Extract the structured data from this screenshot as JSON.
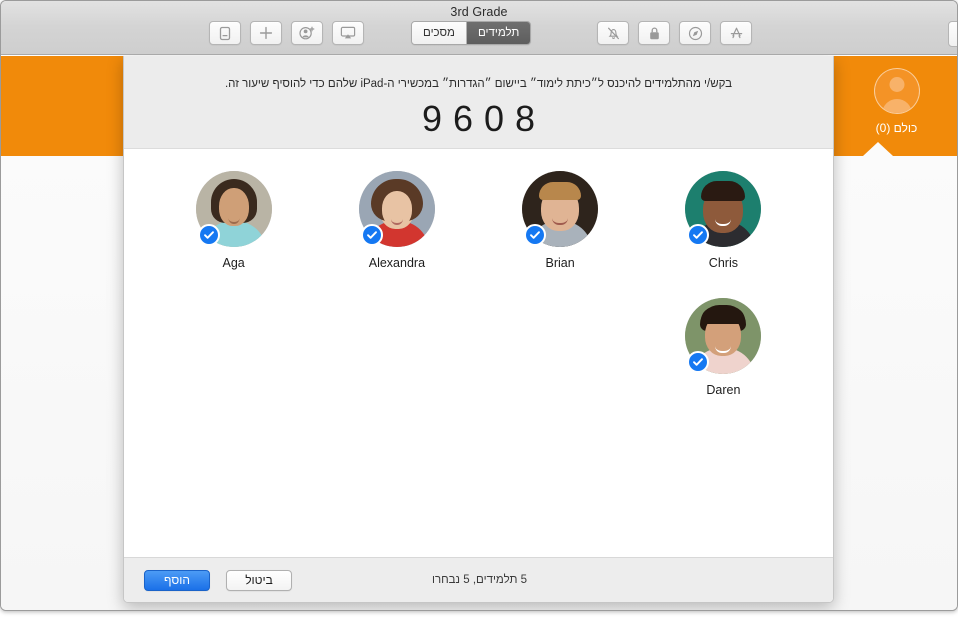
{
  "window": {
    "title": "3rd Grade"
  },
  "toolbar": {
    "left_buttons": [
      {
        "name": "screen-view-icon",
        "label": "תצוגת מסך"
      },
      {
        "name": "plus-icon",
        "label": "הוסף"
      },
      {
        "name": "add-person-icon",
        "label": "הוסף אדם"
      },
      {
        "name": "airplay-icon",
        "label": "AirPlay"
      }
    ],
    "segmented": {
      "options": [
        "מסכים",
        "תלמידים"
      ],
      "selected": "תלמידים"
    },
    "right_buttons": [
      {
        "name": "mute-bell-icon",
        "label": "השתק"
      },
      {
        "name": "lock-icon",
        "label": "נעל"
      },
      {
        "name": "safari-compass-icon",
        "label": "Safari"
      },
      {
        "name": "app-store-icon",
        "label": "App Store"
      }
    ]
  },
  "class_tile": {
    "label": "כולם (0)",
    "accent_color": "#f18a0a"
  },
  "sheet": {
    "instruction": "בקש/י מהתלמידים להיכנס ל״כיתת לימוד״ ביישום ״הגדרות״ במכשירי ה-iPad שלהם כדי להוסיף שיעור זה.",
    "code": "9608",
    "students": [
      {
        "name": "Chris",
        "selected": true,
        "bg": "#1d7f6e",
        "skin": "#8e5a3b",
        "hair": "#2a1a12",
        "shirt": "#2c2c30"
      },
      {
        "name": "Brian",
        "selected": true,
        "bg": "#2e241c",
        "skin": "#e0b494",
        "hair": "#b8874c",
        "shirt": "#a9b2bb"
      },
      {
        "name": "Alexandra",
        "selected": true,
        "bg": "#9aa6b4",
        "skin": "#e8c3a4",
        "hair": "#5a3a26",
        "shirt": "#d2362f"
      },
      {
        "name": "Aga",
        "selected": true,
        "bg": "#b9b4a5",
        "skin": "#cf9f77",
        "hair": "#3a2a1e",
        "shirt": "#8fd3d8"
      },
      {
        "name": "Daren",
        "selected": true,
        "bg": "#7e9469",
        "skin": "#d3a07a",
        "hair": "#24170f",
        "shirt": "#efd3cd"
      }
    ],
    "footer": {
      "add_label": "הוסף",
      "cancel_label": "ביטול",
      "status": "5 תלמידים, 5 נבחרו"
    }
  }
}
